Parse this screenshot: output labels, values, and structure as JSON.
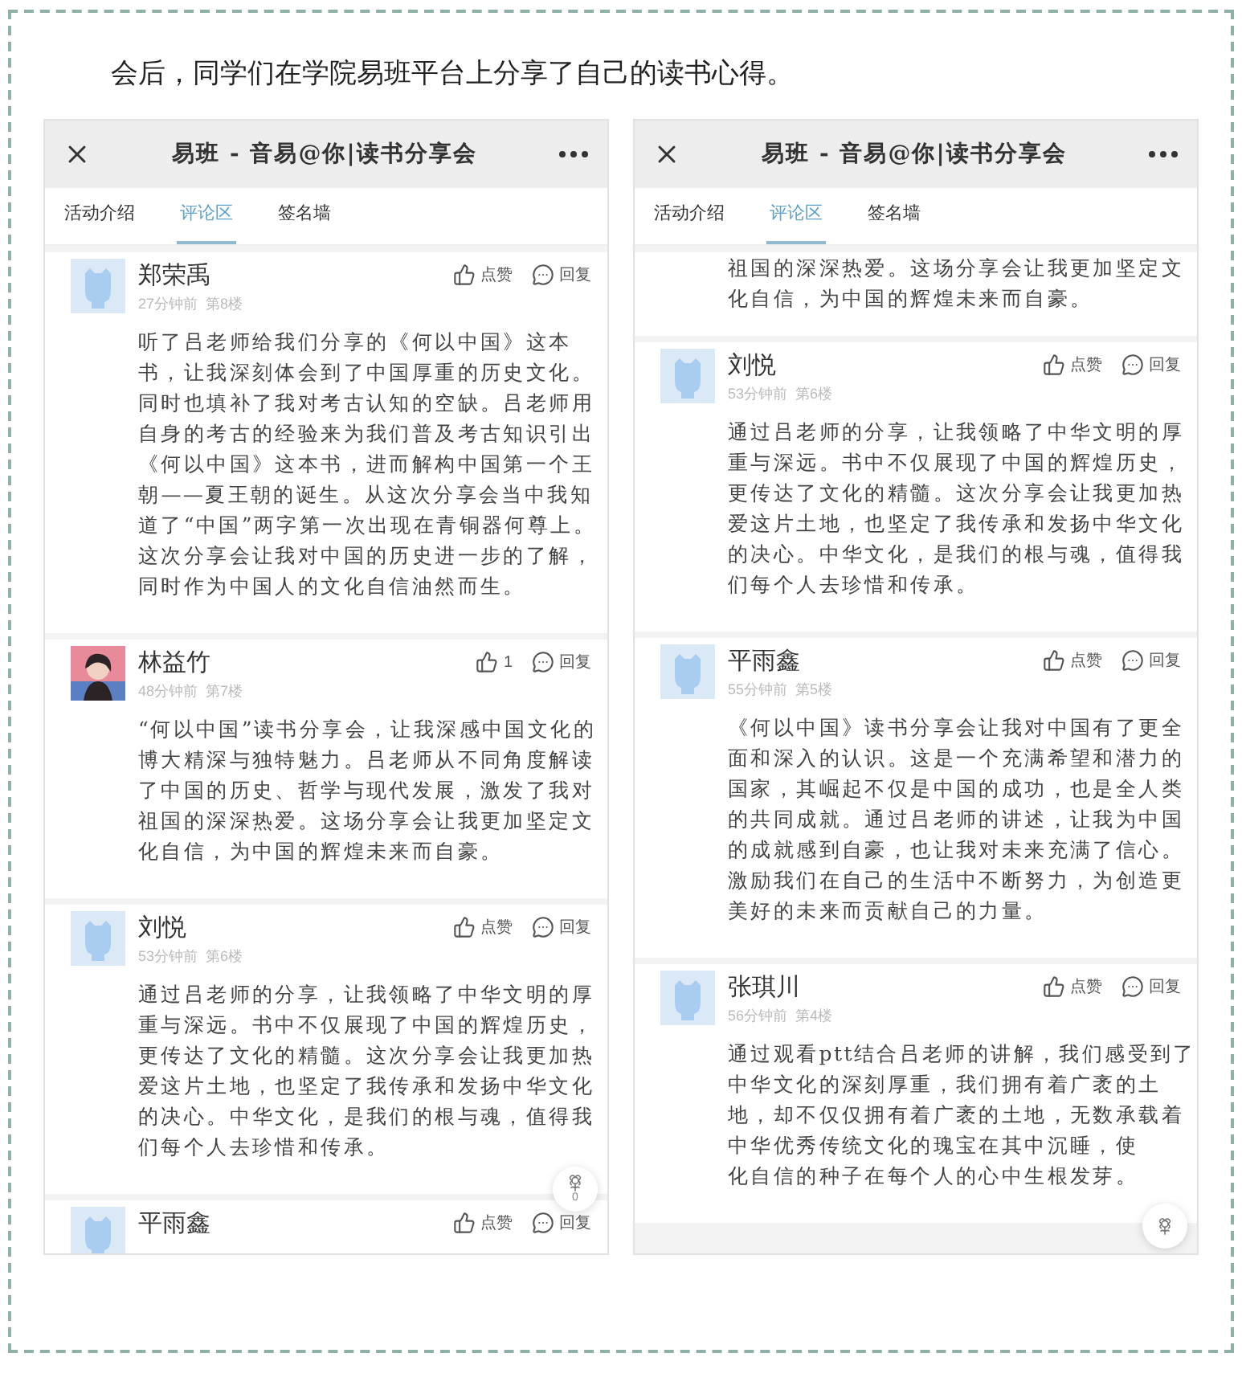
{
  "caption": "会后，同学们在学院易班平台上分享了自己的读书心得。",
  "phones": [
    {
      "title": "易班 - 音易@你|读书分享会",
      "tabs": [
        {
          "label": "活动介绍",
          "selected": false
        },
        {
          "label": "评论区",
          "selected": true
        },
        {
          "label": "签名墙",
          "selected": false
        }
      ],
      "comments": [
        {
          "kind": "comment",
          "name": "郑荣禹",
          "meta": "27分钟前  第8楼",
          "like": "点赞",
          "reply": "回复",
          "lines": [
            "听了吕老师给我们分享的《何以中国》这本",
            "书，让我深刻体会到了中国厚重的历史文化。",
            "同时也填补了我对考古认知的空缺。吕老师用",
            "自身的考古的经验来为我们普及考古知识引出",
            "《何以中国》这本书，进而解构中国第一个王",
            "朝——夏王朝的诞生。从这次分享会当中我知",
            "道了“中国”两字第一次出现在青铜器何尊上。",
            "这次分享会让我对中国的历史进一步的了解，",
            "同时作为中国人的文化自信油然而生。"
          ]
        },
        {
          "kind": "photo_comment",
          "name": "林益竹",
          "meta": "48分钟前  第7楼",
          "like": "1",
          "reply": "回复",
          "lines": [
            "“何以中国”读书分享会，让我深感中国文化的",
            "博大精深与独特魅力。吕老师从不同角度解读",
            "了中国的历史、哲学与现代发展，激发了我对",
            "祖国的深深热爱。这场分享会让我更加坚定文",
            "化自信，为中国的辉煌未来而自豪。"
          ]
        },
        {
          "kind": "comment",
          "name": "刘悦",
          "meta": "53分钟前  第6楼",
          "like": "点赞",
          "reply": "回复",
          "lines": [
            "通过吕老师的分享，让我领略了中华文明的厚",
            "重与深远。书中不仅展现了中国的辉煌历史，",
            "更传达了文化的精髓。这次分享会让我更加热",
            "爱这片土地，也坚定了我传承和发扬中华文化",
            "的决心。中华文化，是我们的根与魂，值得我",
            "们每个人去珍惜和传承。"
          ]
        },
        {
          "kind": "comment",
          "name": "平雨鑫",
          "like": "点赞",
          "reply": "回复"
        }
      ],
      "float_count": "0"
    },
    {
      "title": "易班 - 音易@你|读书分享会",
      "tabs": [
        {
          "label": "活动介绍",
          "selected": false
        },
        {
          "label": "评论区",
          "selected": true
        },
        {
          "label": "签名墙",
          "selected": false
        }
      ],
      "comments": [
        {
          "kind": "tail",
          "lines": [
            "祖国的深深热爱。这场分享会让我更加坚定文",
            "化自信，为中国的辉煌未来而自豪。"
          ]
        },
        {
          "kind": "comment",
          "name": "刘悦",
          "meta": "53分钟前  第6楼",
          "like": "点赞",
          "reply": "回复",
          "lines": [
            "通过吕老师的分享，让我领略了中华文明的厚",
            "重与深远。书中不仅展现了中国的辉煌历史，",
            "更传达了文化的精髓。这次分享会让我更加热",
            "爱这片土地，也坚定了我传承和发扬中华文化",
            "的决心。中华文化，是我们的根与魂，值得我",
            "们每个人去珍惜和传承。"
          ]
        },
        {
          "kind": "comment",
          "name": "平雨鑫",
          "meta": "55分钟前  第5楼",
          "like": "点赞",
          "reply": "回复",
          "lines": [
            "《何以中国》读书分享会让我对中国有了更全",
            "面和深入的认识。这是一个充满希望和潜力的",
            "国家，其崛起不仅是中国的成功，也是全人类",
            "的共同成就。通过吕老师的讲述，让我为中国",
            "的成就感到自豪，也让我对未来充满了信心。",
            "激励我们在自己的生活中不断努力，为创造更",
            "美好的未来而贡献自己的力量。"
          ]
        },
        {
          "kind": "comment",
          "name": "张琪川",
          "meta": "56分钟前  第4楼",
          "like": "点赞",
          "reply": "回复",
          "lines": [
            "通过观看ptt结合吕老师的讲解，我们感受到了",
            "中华文化的深刻厚重，我们拥有着广袤的土",
            "地，却不仅仅拥有着广袤的土地，无数承载着",
            "中华优秀传统文化的瑰宝在其中沉睡，使",
            "化自信的种子在每个人的心中生根发芽。"
          ]
        }
      ]
    }
  ]
}
